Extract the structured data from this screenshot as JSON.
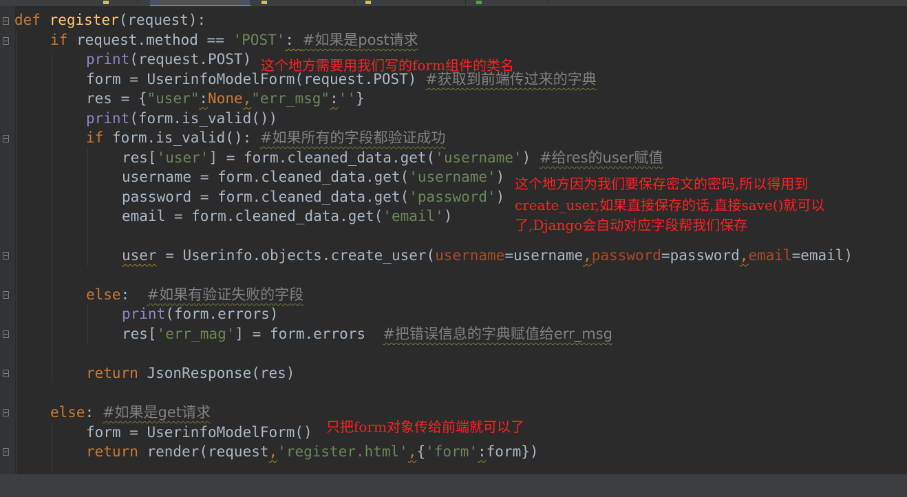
{
  "code": {
    "def_kw": "def",
    "func_name": "register",
    "def_params": "(request):",
    "l2_if": "if",
    "l2_expr": " request.method == ",
    "l2_str": "'POST'",
    "l2_colon": ": ",
    "l2_comment": "#如果是post请求",
    "l3_print": "print",
    "l3_rest": "(request.POST)",
    "l4_lhs": "form = UserinfoModelForm(request.POST) ",
    "l4_comment": "#获取到前端传过来的字典",
    "l5_pre": "res = {",
    "l5_user": "\"user\"",
    "l5_colon": ":",
    "l5_none": "None",
    "l5_comma": ",",
    "l5_errmsg": "\"err_msg\"",
    "l5_colon2": ":",
    "l5_empty": "''",
    "l5_close": "}",
    "l6_print": "print",
    "l6_rest": "(form.is_valid())",
    "l7_if": "if",
    "l7_expr": " form.is_valid(): ",
    "l7_comment": "#如果所有的字段都验证成功",
    "l8_pre": "res[",
    "l8_key": "'user'",
    "l8_mid": "] = form.cleaned_data.get(",
    "l8_arg": "'username'",
    "l8_close": ") ",
    "l8_comment": "#给res的user赋值",
    "l9_pre": "username = form.cleaned_data.get(",
    "l9_arg": "'username'",
    "l9_close": ")",
    "l10_pre": "password = form.cleaned_data.get(",
    "l10_arg": "'password'",
    "l10_close": ")",
    "l11_pre": "email = form.cleaned_data.get(",
    "l11_arg": "'email'",
    "l11_close": ")",
    "l12_var": "user",
    "l12_mid": " = Userinfo.objects.create_user(",
    "l12_p1": "username",
    "l12_v1": "=username",
    "l12_c1": ",",
    "l12_p2": "password",
    "l12_v2": "=password",
    "l12_c2": ",",
    "l12_p3": "email",
    "l12_v3": "=email)",
    "l13_else": "else",
    "l13_colon": ":  ",
    "l13_comment": "#如果有验证失败的字段",
    "l14_print": "print",
    "l14_rest": "(form.errors)",
    "l15_pre": "res[",
    "l15_key": "'err_mag'",
    "l15_mid": "] = form.errors  ",
    "l15_comment": "#把错误信息的字典赋值给err_msg",
    "l16_return": "return",
    "l16_rest": " JsonResponse(res)",
    "l17_else": "else",
    "l17_colon": ": ",
    "l17_comment": "#如果是get请求",
    "l18_text": "form = UserinfoModelForm()",
    "l19_return": "return",
    "l19_pre": " render(request",
    "l19_c1": ",",
    "l19_str": "'register.html'",
    "l19_c2": ",",
    "l19_brace": "{",
    "l19_key": "'form'",
    "l19_colon": ":",
    "l19_end": "form})"
  },
  "notes": {
    "n1": "这个地方需要用我们写的form组件的类名",
    "n2_l1": "这个地方因为我们要保存密文的密码,所以得用到",
    "n2_l2": "create_user,如果直接保存的话,直接save()就可以",
    "n2_l3": "了,Django会自动对应字段帮我们保存",
    "n3": "只把form对象传给前端就可以了"
  },
  "colors": {
    "background": "#2b2b2b",
    "keyword": "#cc7832",
    "string": "#6a8759",
    "function": "#ffc66d",
    "builtin": "#8888c6",
    "comment": "#808080",
    "annotation": "#ff2020"
  }
}
